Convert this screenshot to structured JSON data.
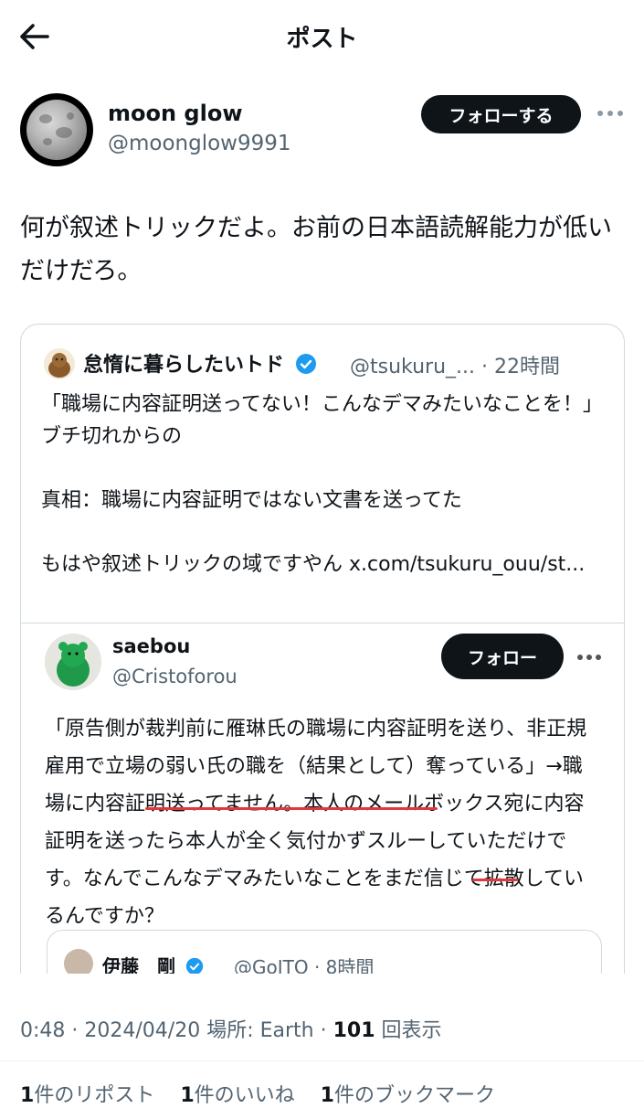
{
  "header": {
    "title": "ポスト"
  },
  "post": {
    "display_name": "moon glow",
    "handle": "@moonglow9991",
    "follow_label": "フォローする",
    "text": "何が叙述トリックだよ。お前の日本語読解能力が低いだけだろ。"
  },
  "quote": {
    "display_name": "怠惰に暮らしたいトド",
    "handle_time": "@tsukuru_... · 22時間",
    "text_line1": "「職場に内容証明送ってない！こんなデマみたいなことを！」ブチ切れからの",
    "text_line2": "真相：職場に内容証明ではない文書を送ってた",
    "text_line3": "もはや叙述トリックの域ですやん x.com/tsukuru_ouu/st..."
  },
  "embedded": {
    "display_name": "saebou",
    "handle": "@Cristoforou",
    "follow_label": "フォロー",
    "text_part1": "「原告側が裁判前に雁琳氏の職場に内容証明を送り、非正規雇用で立場の弱い氏の職を（結果として）奪っている」→",
    "text_highlight": "職場に内容証明送ってません",
    "text_part2": "。本人のメールボックス宛に内容証明を送ったら本人が全く気付かずスルーしていただけです。なんでこんなデマみたいなことをまだ信じて拡散しているんですか？"
  },
  "nested": {
    "display_name": "伊藤　剛",
    "handle_time": "@GoITO · 8時間"
  },
  "meta": {
    "time": "0:48",
    "sep1": " · ",
    "date": "2024/04/20",
    "location_label": " 場所: ",
    "location": "Earth",
    "sep2": " · ",
    "views_count": "101",
    "views_label": " 回表示"
  },
  "stats": {
    "reposts_count": "1",
    "reposts_label": "件のリポスト",
    "likes_count": "1",
    "likes_label": "件のいいね",
    "bookmarks_count": "1",
    "bookmarks_label": "件のブックマーク"
  },
  "colors": {
    "accent_dark": "#0f1419",
    "secondary_text": "#536471",
    "verified": "#1d9bf0",
    "highlight_underline": "#e0383b"
  },
  "icons": [
    "back-arrow-icon",
    "more-icon",
    "verified-badge-icon"
  ]
}
